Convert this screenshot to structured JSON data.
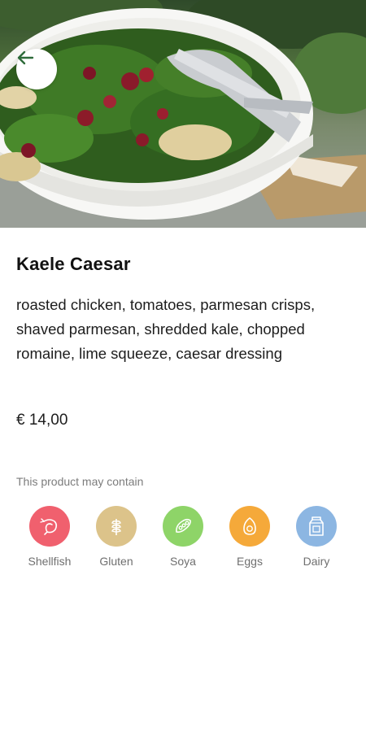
{
  "product": {
    "name": "Kaele Caesar",
    "description": "roasted chicken, tomatoes, parmesan crisps, shaved parmesan, shredded kale, chopped romaine, lime squeeze, caesar dressing",
    "price": "€ 14,00"
  },
  "header": {
    "back_icon": "arrow-left-icon"
  },
  "allergens": {
    "heading": "This product may contain",
    "items": [
      {
        "label": "Shellfish",
        "icon": "shrimp-icon",
        "color": "#f0606e"
      },
      {
        "label": "Gluten",
        "icon": "wheat-icon",
        "color": "#dcc38a"
      },
      {
        "label": "Soya",
        "icon": "soy-pod-icon",
        "color": "#8ed468"
      },
      {
        "label": "Eggs",
        "icon": "egg-icon",
        "color": "#f5a93a"
      },
      {
        "label": "Dairy",
        "icon": "milk-carton-icon",
        "color": "#8cb6e2"
      }
    ]
  },
  "colors": {
    "accent": "#2e6b3a",
    "text": "#1d1d1d",
    "muted": "#7c7c7c"
  }
}
